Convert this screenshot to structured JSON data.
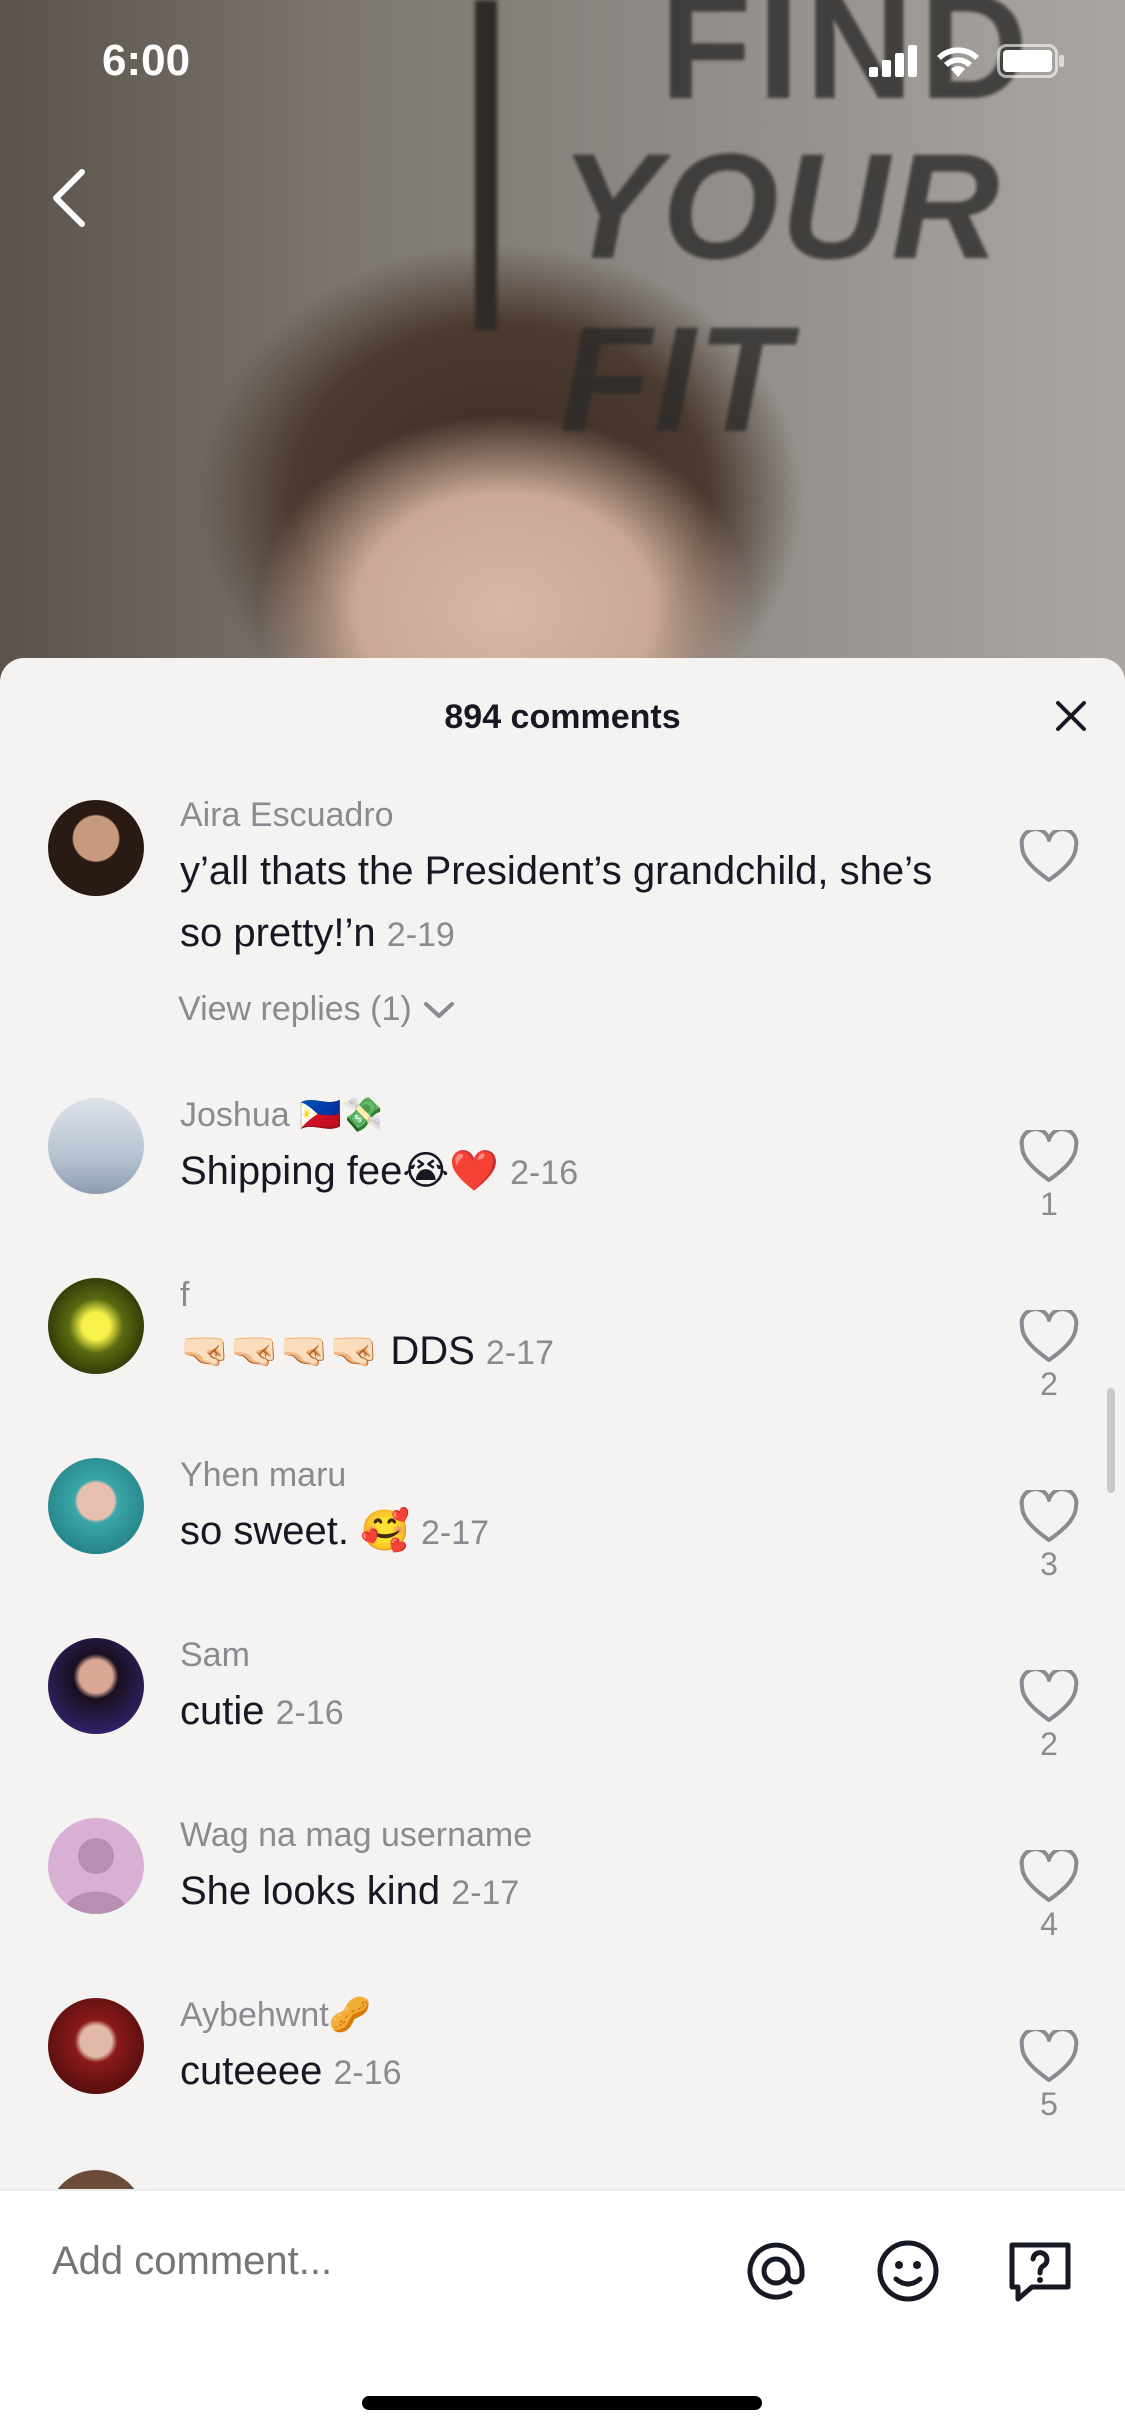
{
  "status_bar": {
    "time": "6:00"
  },
  "video": {
    "wall_line_1": "FIND",
    "wall_line_2": "YOUR FIT"
  },
  "sheet": {
    "title": "894 comments",
    "comments": [
      {
        "user": "Aira Escuadro",
        "text": "y’all thats the President’s grandchild, she’s so pretty!’n",
        "date": "2-19",
        "likes": "",
        "replies": "View replies (1)"
      },
      {
        "user": "Joshua 🇵🇭💸",
        "text": "Shipping fee😭❤️",
        "date": "2-16",
        "likes": "1"
      },
      {
        "user": "f",
        "text": "🤜🏻🤜🏻🤜🏻🤜🏻 DDS",
        "date": "2-17",
        "likes": "2"
      },
      {
        "user": "Yhen maru",
        "text": "so sweet. 🥰",
        "date": "2-17",
        "likes": "3"
      },
      {
        "user": "Sam",
        "text": "cutie",
        "date": "2-16",
        "likes": "2"
      },
      {
        "user": "Wag na mag username",
        "text": "She looks kind",
        "date": "2-17",
        "likes": "4"
      },
      {
        "user": "Aybehwnt🥜",
        "text": "cuteeee",
        "date": "2-16",
        "likes": "5"
      }
    ]
  },
  "input": {
    "placeholder": "Add comment..."
  },
  "colors": {
    "sheet_bg": "#f4f3f2",
    "muted": "#8a8b91",
    "text": "#161823"
  }
}
